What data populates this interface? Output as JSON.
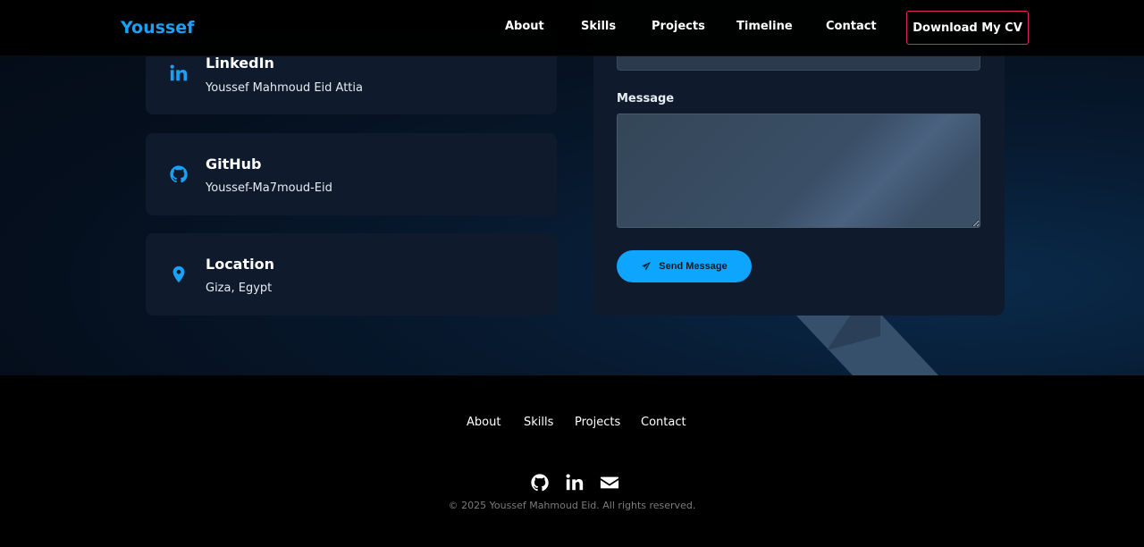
{
  "navbar": {
    "logo": "Youssef",
    "links": [
      "About",
      "Skills",
      "Projects",
      "Timeline",
      "Contact"
    ],
    "cv_button": "Download My CV"
  },
  "contact_cards": [
    {
      "icon": "linkedin-icon",
      "title": "LinkedIn",
      "value": "Youssef Mahmoud Eid Attia"
    },
    {
      "icon": "github-icon",
      "title": "GitHub",
      "value": "Youssef-Ma7moud-Eid"
    },
    {
      "icon": "location-pin-icon",
      "title": "Location",
      "value": "Giza, Egypt"
    }
  ],
  "form": {
    "message_label": "Message",
    "message_value": "",
    "send_button": "Send Message"
  },
  "footer": {
    "links": [
      "About",
      "Skills",
      "Projects",
      "Contact"
    ],
    "social_icons": [
      "github-icon",
      "linkedin-icon",
      "envelope-icon"
    ],
    "copyright": "© 2025 Youssef Mahmoud Eid. All rights reserved."
  },
  "colors": {
    "accent": "#0ea5ff",
    "logo": "#1aa0f5",
    "cv_border": "#e0245e",
    "card_bg": "#0f1b2c"
  }
}
